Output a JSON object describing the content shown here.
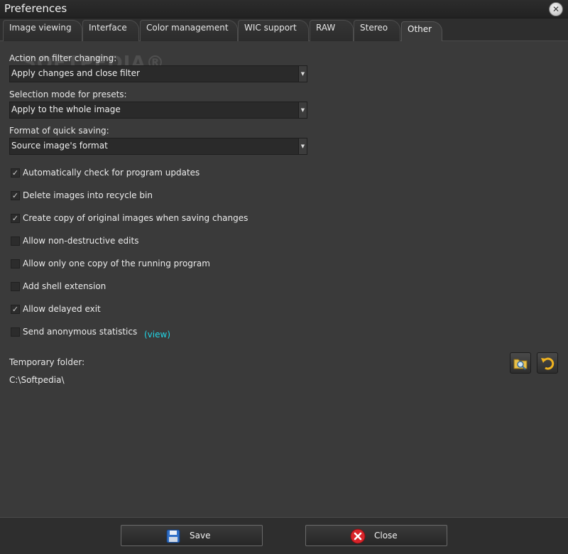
{
  "window": {
    "title": "Preferences"
  },
  "tabs": [
    {
      "label": "Image viewing"
    },
    {
      "label": "Interface"
    },
    {
      "label": "Color management"
    },
    {
      "label": "WIC support"
    },
    {
      "label": "RAW"
    },
    {
      "label": "Stereo"
    },
    {
      "label": "Other",
      "active": true
    }
  ],
  "watermark": "SOFTPEDIA®",
  "fields": {
    "filter_action": {
      "label": "Action on filter changing:",
      "value": "Apply changes and close filter"
    },
    "selection_mode": {
      "label": "Selection mode for presets:",
      "value": "Apply to the whole image"
    },
    "quick_save_format": {
      "label": "Format of quick saving:",
      "value": "Source image's format"
    }
  },
  "checkboxes": [
    {
      "label": "Automatically check for program updates",
      "checked": true
    },
    {
      "label": "Delete images into recycle bin",
      "checked": true
    },
    {
      "label": "Create copy of original images when saving changes",
      "checked": true
    },
    {
      "label": "Allow non-destructive edits",
      "checked": false
    },
    {
      "label": "Allow only one copy of the running program",
      "checked": false
    },
    {
      "label": "Add shell extension",
      "checked": false
    },
    {
      "label": "Allow delayed exit",
      "checked": true
    },
    {
      "label": "Send anonymous statistics",
      "checked": false
    }
  ],
  "statistics_link": "(view)",
  "temp_folder": {
    "label": "Temporary folder:",
    "path": "C:\\Softpedia\\"
  },
  "icons": {
    "browse": "folder-search-icon",
    "reset": "undo-icon",
    "save": "floppy-disk-icon",
    "close": "red-close-icon"
  },
  "buttons": {
    "save": "Save",
    "close": "Close"
  },
  "colors": {
    "background": "#3a3a3a",
    "link": "#22d6e6",
    "close_red": "#d9242a"
  }
}
